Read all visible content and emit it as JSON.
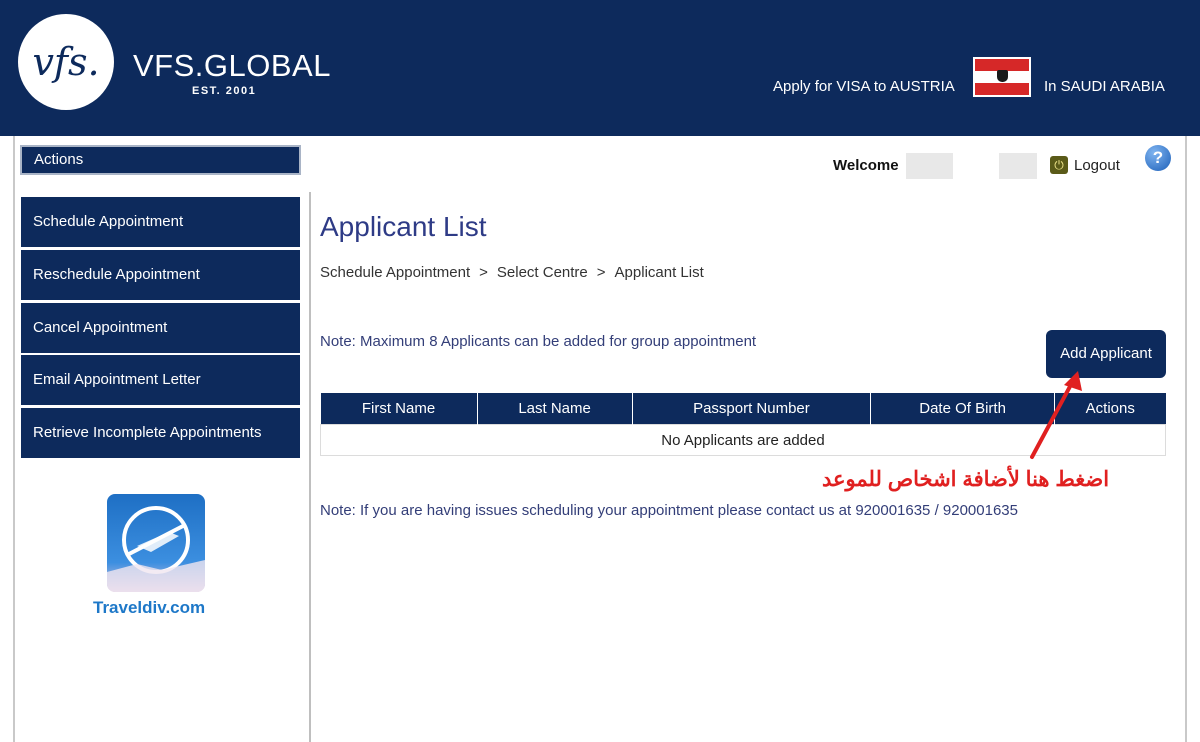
{
  "header": {
    "logo_mark": "vfs.",
    "brand_name": "VFS.GLOBAL",
    "brand_est": "EST. 2001",
    "visa_text": "Apply for VISA to AUSTRIA",
    "country_text": "In SAUDI ARABIA",
    "colors": {
      "navy": "#0d2a5c",
      "flag_red": "#d62828"
    }
  },
  "sidebar": {
    "header": "Actions",
    "items": [
      {
        "label": "Schedule Appointment"
      },
      {
        "label": "Reschedule Appointment"
      },
      {
        "label": "Cancel Appointment"
      },
      {
        "label": "Email Appointment Letter"
      },
      {
        "label": "Retrieve Incomplete Appointments"
      }
    ],
    "promo_text": "Traveldiv.com"
  },
  "topbar": {
    "welcome": "Welcome",
    "logout": "Logout",
    "help": "?"
  },
  "main": {
    "title": "Applicant List",
    "breadcrumb": [
      "Schedule Appointment",
      "Select Centre",
      "Applicant List"
    ],
    "breadcrumb_sep": ">",
    "note_max": "Note: Maximum 8 Applicants can be added for group appointment",
    "add_button": "Add Applicant",
    "table": {
      "columns": [
        "First Name",
        "Last Name",
        "Passport Number",
        "Date Of Birth",
        "Actions"
      ],
      "empty_message": "No Applicants are added"
    },
    "annotation": "اضغط هنا لأضافة اشخاص للموعد",
    "note_contact": "Note: If you are having issues scheduling your appointment please contact us at 920001635 / 920001635"
  }
}
